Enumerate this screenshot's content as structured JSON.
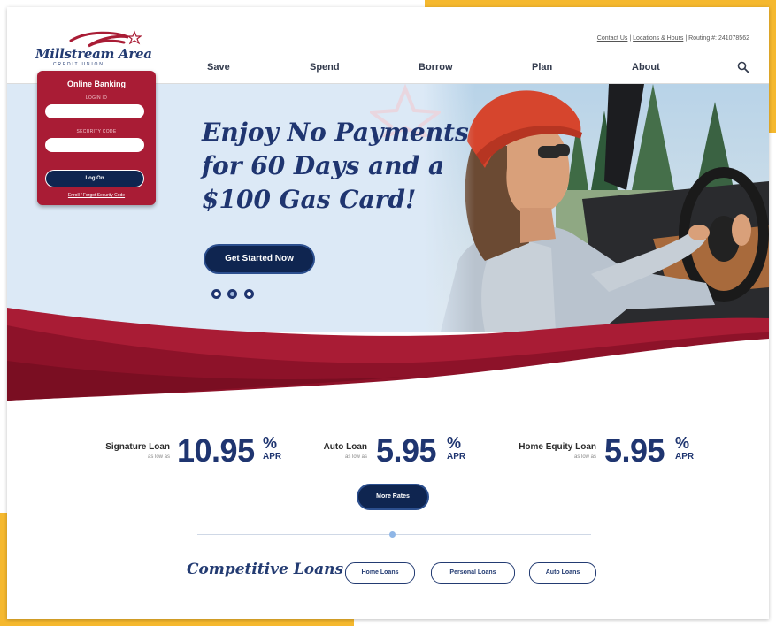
{
  "brand": {
    "name": "Millstream Area",
    "subtitle": "CREDIT UNION"
  },
  "utility": {
    "contact": "Contact Us",
    "locations": "Locations & Hours",
    "sep": "|",
    "routing": "Routing #: 241078562"
  },
  "nav": {
    "items": [
      "Save",
      "Spend",
      "Borrow",
      "Plan",
      "About"
    ]
  },
  "login": {
    "title": "Online Banking",
    "login_label": "LOGIN ID",
    "security_label": "SECURITY CODE",
    "button": "Log On",
    "forgot": "Enroll / Forgot Security Code"
  },
  "hero": {
    "headline_lines": [
      "Enjoy No Payments",
      "for 60 Days and a",
      "$100 Gas Card!"
    ],
    "cta": "Get Started Now",
    "slides": 3,
    "active_slide": 2
  },
  "rates": [
    {
      "name": "Signature Loan",
      "sub": "as low as",
      "value": "10.95",
      "unit": "%",
      "apr": "APR"
    },
    {
      "name": "Auto Loan",
      "sub": "as low as",
      "value": "5.95",
      "unit": "%",
      "apr": "APR"
    },
    {
      "name": "Home Equity Loan",
      "sub": "as low as",
      "value": "5.95",
      "unit": "%",
      "apr": "APR"
    }
  ],
  "more_rates": "More Rates",
  "competitive": {
    "title": "Competitive Loans",
    "pills": [
      "Home Loans",
      "Personal Loans",
      "Auto Loans"
    ]
  },
  "colors": {
    "navy": "#1f3570",
    "crimson": "#a91c35",
    "accent": "#f5b82e",
    "hero_bg": "#dce9f6"
  }
}
